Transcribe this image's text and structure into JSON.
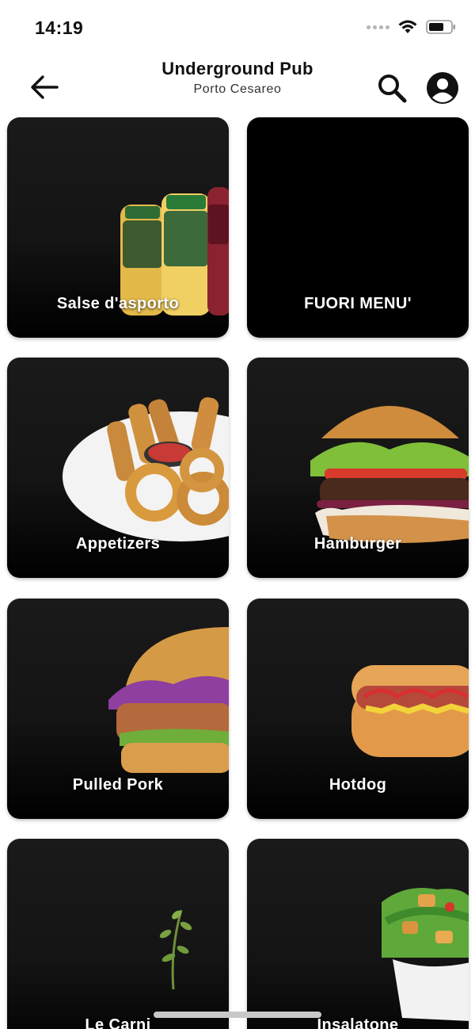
{
  "status_bar": {
    "time": "14:19"
  },
  "header": {
    "title": "Underground Pub",
    "subtitle": "Porto Cesareo"
  },
  "categories": [
    {
      "label": "Salse d'asporto",
      "image": "sauce-bottles"
    },
    {
      "label": "FUORI MENU'",
      "image": "none"
    },
    {
      "label": "Appetizers",
      "image": "appetizer-plate"
    },
    {
      "label": "Hamburger",
      "image": "hamburger"
    },
    {
      "label": "Pulled Pork",
      "image": "pulled-pork-sandwich"
    },
    {
      "label": "Hotdog",
      "image": "hotdog"
    },
    {
      "label": "Le Carni",
      "image": "herb-sprig"
    },
    {
      "label": "Insalatone",
      "image": "salad-bowl"
    }
  ],
  "colors": {
    "card_background": "#141414",
    "card_label": "#ffffff",
    "accent": "#000000"
  }
}
